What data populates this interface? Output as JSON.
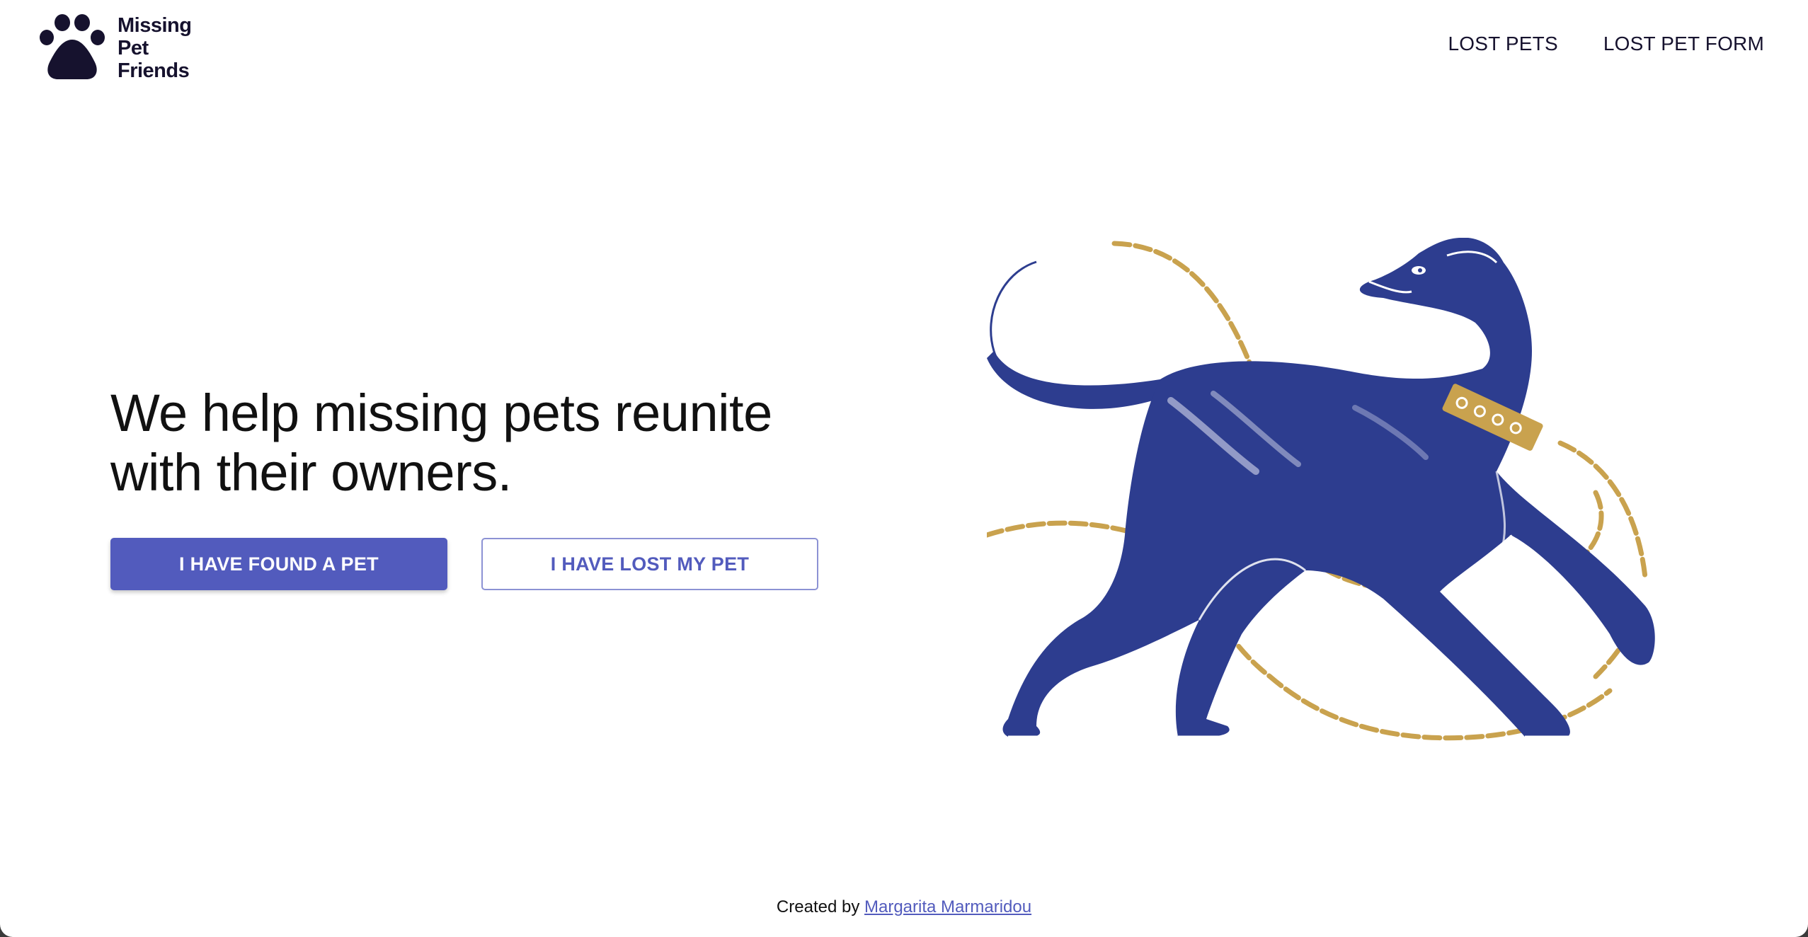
{
  "brand": {
    "name_lines": [
      "Missing",
      "Pet",
      "Friends"
    ],
    "icon": "paw-icon",
    "color": "#16122e"
  },
  "nav": {
    "items": [
      {
        "label": "LOST PETS"
      },
      {
        "label": "LOST PET FORM"
      }
    ]
  },
  "hero": {
    "title": "We help missing pets reunite with their owners.",
    "illustration": "dog-with-chain-illustration",
    "buttons": {
      "found": "I HAVE FOUND A PET",
      "lost": "I HAVE LOST MY PET"
    },
    "accent_color": "#525bbd",
    "dog_color": "#2d3d8f",
    "chain_color": "#c9a24e"
  },
  "footer": {
    "prefix": "Created by",
    "author": "Margarita Marmaridou"
  }
}
